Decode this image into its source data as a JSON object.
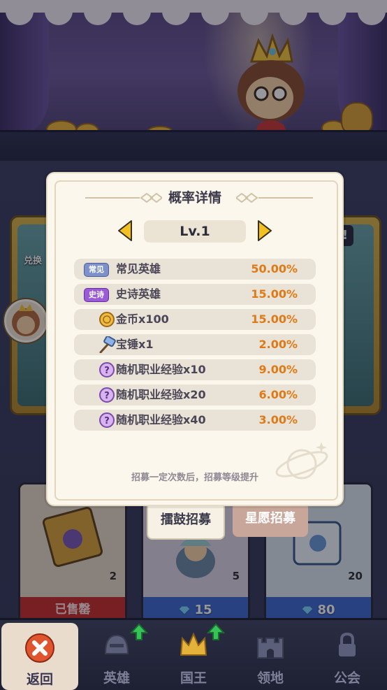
{
  "background": {
    "side_card_left_label": "兑换",
    "side_card_right_badge": "!",
    "shop_cards": [
      {
        "qty": "2",
        "status": "已售罄"
      },
      {
        "qty": "5",
        "price": "15"
      },
      {
        "qty": "20",
        "price": "80"
      }
    ]
  },
  "tabs": {
    "active": "擂鼓招募",
    "inactive": "星愿招募"
  },
  "modal": {
    "title": "概率详情",
    "level": "Lv.1",
    "rows": [
      {
        "icon": "common-badge",
        "badge": "常见",
        "name": "常见英雄",
        "pct": "50.00%"
      },
      {
        "icon": "epic-badge",
        "badge": "史诗",
        "name": "史诗英雄",
        "pct": "15.00%"
      },
      {
        "icon": "coin-icon",
        "name": "金币x100",
        "pct": "15.00%"
      },
      {
        "icon": "hammer-icon",
        "name": "宝锤x1",
        "pct": "2.00%"
      },
      {
        "icon": "mystery-orb-icon",
        "name": "随机职业经验x10",
        "pct": "9.00%"
      },
      {
        "icon": "mystery-orb-icon",
        "name": "随机职业经验x20",
        "pct": "6.00%"
      },
      {
        "icon": "mystery-orb-icon",
        "name": "随机职业经验x40",
        "pct": "3.00%"
      }
    ],
    "footnote": "招募一定次数后，招募等级提升"
  },
  "nav": {
    "items": [
      {
        "label": "返回",
        "icon": "close-icon"
      },
      {
        "label": "英雄",
        "icon": "helmet-icon"
      },
      {
        "label": "国王",
        "icon": "crown-icon"
      },
      {
        "label": "领地",
        "icon": "castle-icon"
      },
      {
        "label": "公会",
        "icon": "lock-icon"
      }
    ]
  },
  "colors": {
    "percent": "#e07a16",
    "modal_bg": "#fbf7ec",
    "row_bg": "#e9e2d6",
    "level_arrow": "#f2c020"
  }
}
